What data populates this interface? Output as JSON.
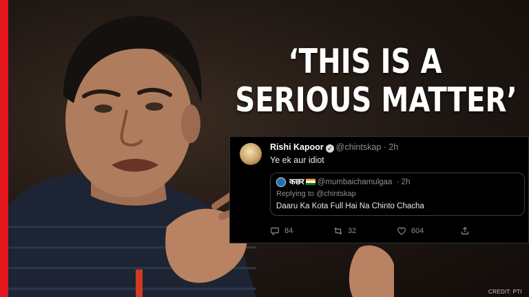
{
  "headline": {
    "line1": "‘THIS IS A",
    "line2": "SERIOUS MATTER’"
  },
  "tweet": {
    "author_name": "Rishi Kapoor",
    "author_handle": "@chintskap",
    "time": "· 2h",
    "text": "Ye ek aur idiot",
    "quoted": {
      "author_name": "कछर",
      "author_handle": "@mumbaichamulgaa",
      "time": "· 2h",
      "replying_to": "Replying to @chintskap",
      "text": "Daaru Ka Kota Full Hai Na Chinto Chacha"
    },
    "actions": {
      "reply_count": "84",
      "retweet_count": "32",
      "like_count": "604"
    }
  },
  "credit": "CREDIT: PTI",
  "colors": {
    "accent_bar": "#e3161b",
    "tweet_bg": "#000000"
  }
}
